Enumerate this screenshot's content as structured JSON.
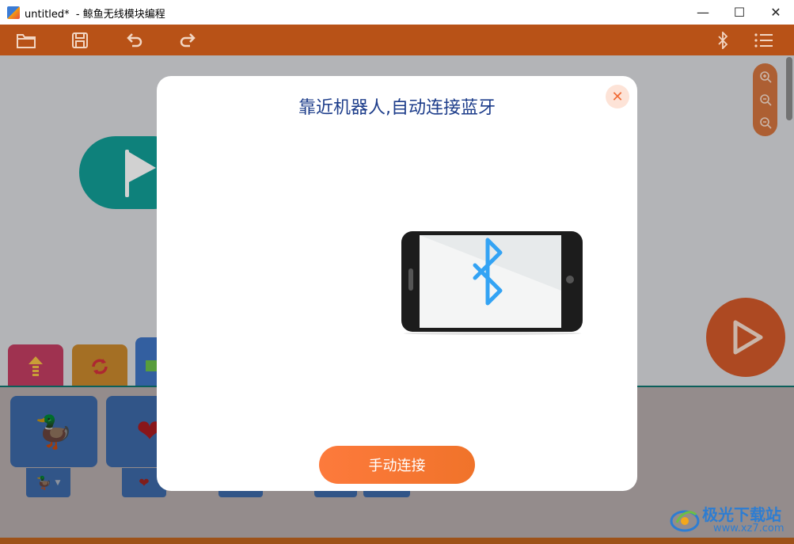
{
  "window": {
    "title": "untitled*  - 鲸鱼无线模块编程",
    "minimize_glyph": "—",
    "maximize_glyph": "☐",
    "close_glyph": "✕"
  },
  "toolbar": {
    "icons": [
      "folder-open-icon",
      "save-icon",
      "undo-icon",
      "redo-icon",
      "bluetooth-icon",
      "menu-icon"
    ]
  },
  "canvas": {
    "zoom_icons": [
      "zoom-in-icon",
      "zoom-reset-icon",
      "zoom-out-icon"
    ],
    "blocks": [
      "flag-block",
      "run-button"
    ]
  },
  "categories": [
    {
      "icon": "arrow-up-icon",
      "color": "#c33e62"
    },
    {
      "icon": "loop-icon",
      "color": "#c9882c"
    },
    {
      "icon": "green-square-icon",
      "color": "#3f75c4"
    }
  ],
  "palette": {
    "blocks": [
      {
        "icon": "duck-icon",
        "glyph": "🦆",
        "dropdown_glyph": "🦆"
      },
      {
        "icon": "heart-icon",
        "glyph": "❤",
        "dropdown_glyph": "❤"
      }
    ]
  },
  "modal": {
    "title": "靠近机器人,自动连接蓝牙",
    "close_glyph": "✕",
    "manual_button_label": "手动连接"
  },
  "watermark": {
    "brand": "极光下载站",
    "url": "www.xz7.com"
  },
  "colors": {
    "toolbar": "#b85217",
    "canvas": "#dbdce0",
    "flag_block": "#129e96",
    "modal_title": "#1c3c8a",
    "modal_button": "#f0732a",
    "bluetooth": "#33a3f4"
  }
}
